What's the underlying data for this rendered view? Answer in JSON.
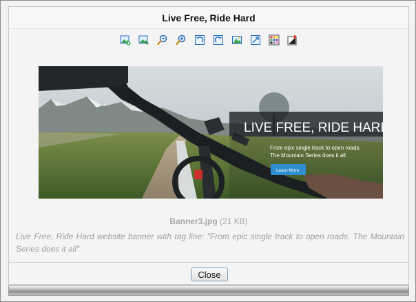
{
  "dialog": {
    "title": "Live Free, Ride Hard"
  },
  "toolbar": {
    "tools": [
      {
        "icon": "insert-image-icon"
      },
      {
        "icon": "save-image-icon"
      },
      {
        "icon": "zoom-out-icon"
      },
      {
        "icon": "zoom-in-icon"
      },
      {
        "icon": "rotate-left-icon"
      },
      {
        "icon": "rotate-right-icon"
      },
      {
        "icon": "fit-image-icon"
      },
      {
        "icon": "actual-size-icon"
      },
      {
        "icon": "color-grid-icon"
      },
      {
        "icon": "color-picker-icon"
      }
    ]
  },
  "banner": {
    "headline": "LIVE FREE, RIDE HARD",
    "subline1": "From epic single track to open roads.",
    "subline2": "The Mountain Series does it all.",
    "cta": "Learn More"
  },
  "file": {
    "name": "Banner3.jpg",
    "size": "(21 KB)"
  },
  "description": "Live Free, Ride Hard website banner with tag line: \"From epic single track to open roads. The Mountain Series does it all\"",
  "footer": {
    "close_label": "Close"
  },
  "colors": {
    "accent_blue": "#2a6ebd",
    "banner_button": "#2f8fd0"
  }
}
